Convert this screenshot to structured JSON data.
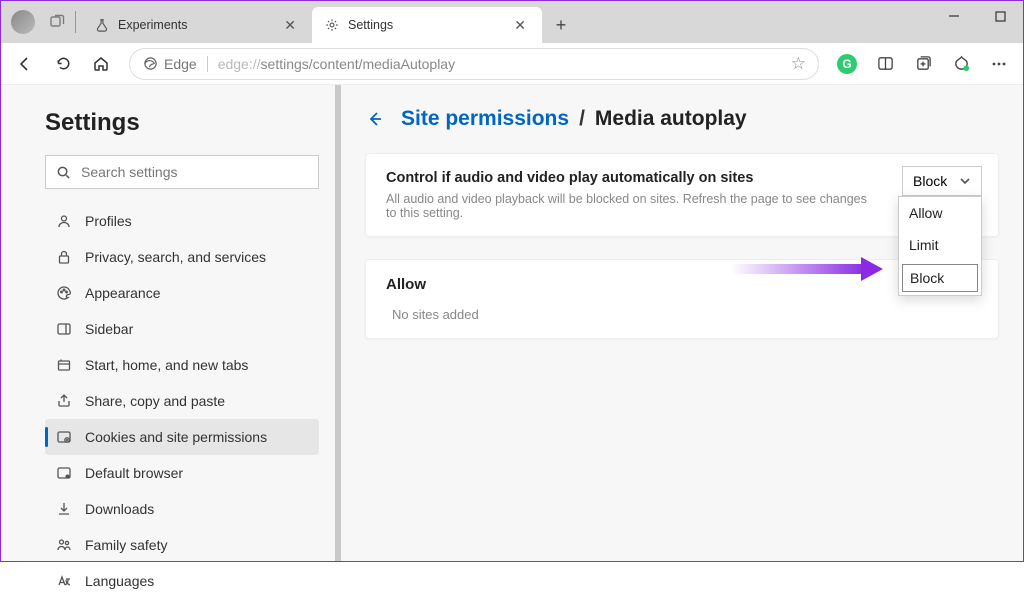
{
  "window": {
    "tabs": [
      {
        "title": "Experiments",
        "icon": "flask-icon"
      },
      {
        "title": "Settings",
        "icon": "gear-icon"
      }
    ],
    "active_tab": 1
  },
  "addressbar": {
    "prefix": "Edge",
    "url_muted": "edge://",
    "url_rest": "settings/content/mediaAutoplay"
  },
  "sidebar": {
    "title": "Settings",
    "search_placeholder": "Search settings",
    "items": [
      {
        "label": "Profiles"
      },
      {
        "label": "Privacy, search, and services"
      },
      {
        "label": "Appearance"
      },
      {
        "label": "Sidebar"
      },
      {
        "label": "Start, home, and new tabs"
      },
      {
        "label": "Share, copy and paste"
      },
      {
        "label": "Cookies and site permissions"
      },
      {
        "label": "Default browser"
      },
      {
        "label": "Downloads"
      },
      {
        "label": "Family safety"
      },
      {
        "label": "Languages"
      }
    ],
    "active_index": 6
  },
  "breadcrumb": {
    "link": "Site permissions",
    "sep": "/",
    "current": "Media autoplay"
  },
  "autoplay_card": {
    "title": "Control if audio and video play automatically on sites",
    "desc": "All audio and video playback will be blocked on sites. Refresh the page to see changes to this setting.",
    "selected": "Block",
    "options": [
      "Allow",
      "Limit",
      "Block"
    ]
  },
  "allow_card": {
    "title": "Allow",
    "empty": "No sites added"
  }
}
